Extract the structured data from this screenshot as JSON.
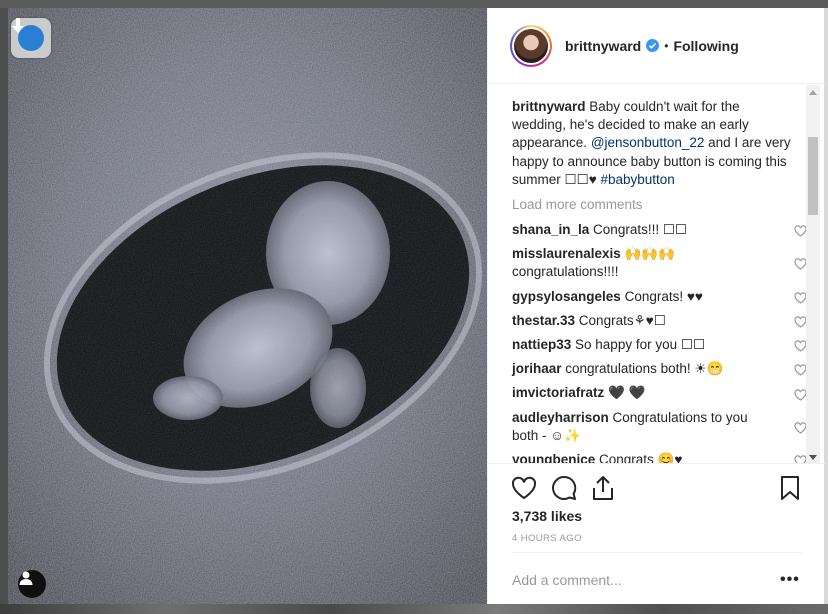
{
  "post": {
    "username": "brittnyward",
    "follow_status": "Following",
    "separator": "•",
    "caption_username": "brittnyward",
    "caption_part1": " Baby couldn't wait for the wedding, he's decided to make an early appearance. ",
    "caption_mention": "@jensonbutton_22",
    "caption_part2": " and I are very happy to announce baby button is coming this summer ☐☐♥ ",
    "caption_hashtag": "#babybutton",
    "load_more": "Load more comments",
    "likes": "3,738 likes",
    "time": "4 HOURS AGO",
    "add_comment_placeholder": "Add a comment...",
    "more_options": "•••"
  },
  "comments": [
    {
      "user": "shana_in_la",
      "text": " Congrats!!! ☐☐"
    },
    {
      "user": "misslaurenalexis",
      "text": " 🙌🙌🙌 congratulations!!!!"
    },
    {
      "user": "gypsylosangeles",
      "text": " Congrats! ♥♥"
    },
    {
      "user": "thestar.33",
      "text": " Congrats⚘♥☐"
    },
    {
      "user": "nattiep33",
      "text": " So happy for you ☐☐"
    },
    {
      "user": "jorihaar",
      "text": " congratulations both! ☀😁"
    },
    {
      "user": "imvictoriafratz",
      "text": " 🖤 🖤"
    },
    {
      "user": "audleyharrison",
      "text": " Congratulations to you both - ☺✨"
    },
    {
      "user": "youngbenice",
      "text": " Congrats 😊♥"
    }
  ],
  "icons": {
    "download": "download-arrow-icon",
    "user_tag": "user-tag-icon",
    "verified": "verified-badge-icon",
    "like": "heart-icon",
    "comment": "comment-icon",
    "share": "share-icon",
    "save": "bookmark-icon",
    "comment_like": "small-heart-icon"
  },
  "colors": {
    "verified": "#3897f0",
    "mention": "#003569",
    "download_button": "#2a7fd4"
  }
}
